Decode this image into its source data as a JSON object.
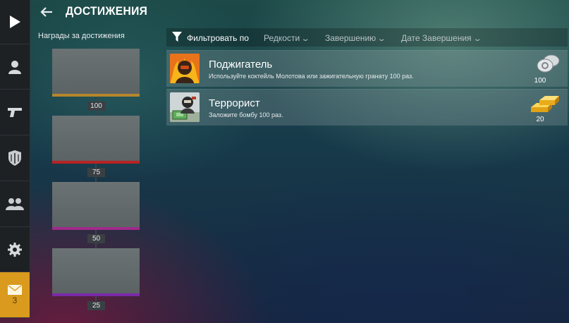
{
  "header": {
    "title": "ДОСТИЖЕНИЯ"
  },
  "sidebar": {
    "items": [
      {
        "name": "play-icon"
      },
      {
        "name": "profile-icon"
      },
      {
        "name": "pistol-icon"
      },
      {
        "name": "shield-icon"
      },
      {
        "name": "friends-icon"
      },
      {
        "name": "gear-icon"
      },
      {
        "name": "mail-icon",
        "badge": "3"
      }
    ]
  },
  "rewards": {
    "label": "Награды за достижения",
    "tiers": [
      {
        "value": "100",
        "color": "#b5862c"
      },
      {
        "value": "75",
        "color": "#b82323"
      },
      {
        "value": "50",
        "color": "#a02a8a"
      },
      {
        "value": "25",
        "color": "#7a2aa8"
      }
    ]
  },
  "filter": {
    "label": "Фильтровать по",
    "options": [
      "Редкости",
      "Завершению",
      "Дате Завершения"
    ]
  },
  "achievements": [
    {
      "name": "Поджигатель",
      "description": "Используйте коктейль Молотова или зажигательную гранату 100 раз.",
      "reward": "100",
      "reward_type": "silver-coins-icon"
    },
    {
      "name": "Террорист",
      "description": "Заложите бомбу 100 раз.",
      "reward": "20",
      "reward_type": "gold-bars-icon"
    }
  ]
}
